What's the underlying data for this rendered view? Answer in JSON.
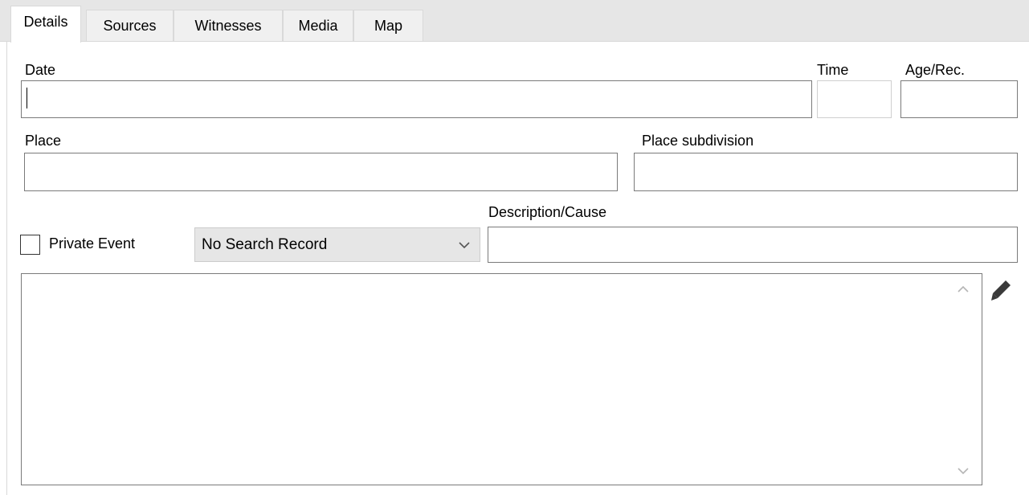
{
  "tabs": [
    {
      "label": "Details"
    },
    {
      "label": "Sources"
    },
    {
      "label": "Witnesses"
    },
    {
      "label": "Media"
    },
    {
      "label": "Map"
    }
  ],
  "active_tab": "Details",
  "fields": {
    "date": {
      "label": "Date",
      "value": ""
    },
    "time": {
      "label": "Time",
      "value": ""
    },
    "age_rec": {
      "label": "Age/Rec.",
      "value": ""
    },
    "place": {
      "label": "Place",
      "value": ""
    },
    "place_subdivision": {
      "label": "Place subdivision",
      "value": ""
    },
    "description_cause": {
      "label": "Description/Cause",
      "value": ""
    }
  },
  "private_event": {
    "label": "Private Event",
    "checked": false
  },
  "search_record": {
    "selected": "No Search Record"
  },
  "notes": {
    "value": ""
  },
  "icons": {
    "dropdown": "chevron-down-icon",
    "scroll_up": "chevron-up-icon",
    "scroll_down": "chevron-down-icon",
    "edit": "pencil-icon"
  },
  "colors": {
    "tabstrip_bg": "#e6e6e6",
    "combo_bg": "#e6e6e6",
    "field_border": "#7a7a7a"
  }
}
